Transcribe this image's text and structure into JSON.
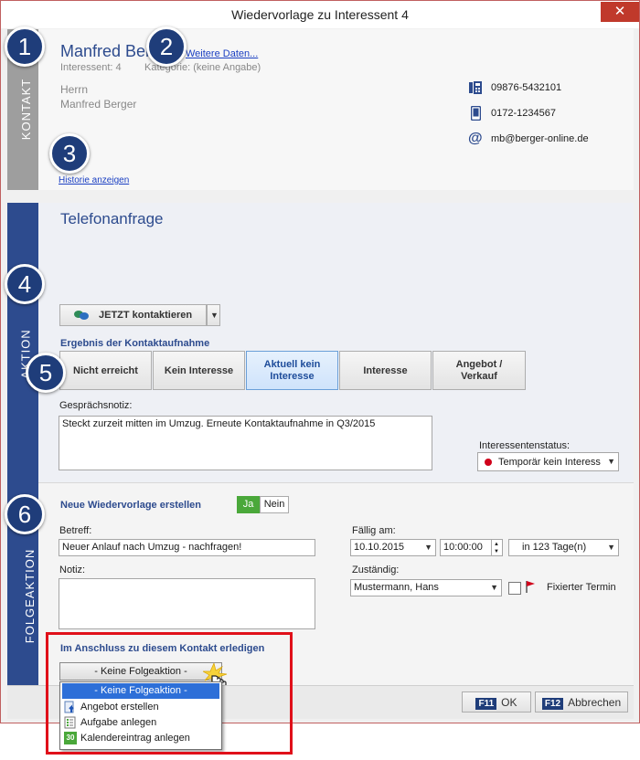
{
  "window": {
    "title": "Wiedervorlage zu Interessent 4",
    "close": "✕"
  },
  "badges": [
    "1",
    "2",
    "3",
    "4",
    "5",
    "6"
  ],
  "sidebar": {
    "kontakt": "KONTAKT",
    "aktion": "AKTION",
    "folgeaktion": "FOLGEAKTION"
  },
  "contact": {
    "name": "Manfred Berger",
    "interessent": "Interessent: 4",
    "kategorie": "Kategorie: (keine Angabe)",
    "weitere_daten": "Weitere Daten...",
    "salutation": "Herrn",
    "fullname": "Manfred Berger",
    "phone": "09876-5432101",
    "mobile": "0172-1234567",
    "email": "mb@berger-online.de",
    "historie": "Historie anzeigen"
  },
  "aktion": {
    "title": "Telefonanfrage",
    "contact_button": "JETZT kontaktieren",
    "ergebnis_title": "Ergebnis der Kontaktaufnahme",
    "results": [
      "Nicht erreicht",
      "Kein Interesse",
      "Aktuell kein Interesse",
      "Interesse",
      "Angebot / Verkauf"
    ],
    "active_result": "Aktuell kein Interesse",
    "notiz_label": "Gesprächsnotiz:",
    "notiz_value": "Steckt zurzeit mitten im Umzug. Erneute Kontaktaufnahme in Q3/2015",
    "status_label": "Interessentenstatus:",
    "status_value": "Temporär kein Interess",
    "status_color": "#d0021b"
  },
  "folge": {
    "title": "Neue Wiedervorlage erstellen",
    "ja": "Ja",
    "nein": "Nein",
    "betreff_label": "Betreff:",
    "betreff_value": "Neuer Anlauf nach Umzug - nachfragen!",
    "faellig_label": "Fällig am:",
    "date": "10.10.2015",
    "time": "10:00:00",
    "days": "in 123 Tage(n)",
    "notiz_label": "Notiz:",
    "zustaendig_label": "Zuständig:",
    "zustaendig_value": "Mustermann, Hans",
    "fixiert": "Fixierter Termin",
    "erledigen_title": "Im Anschluss zu diesem Kontakt erledigen",
    "select_value": "- Keine Folgeaktion -",
    "options": [
      "- Keine Folgeaktion -",
      "Angebot erstellen",
      "Aufgabe anlegen",
      "Kalendereintrag anlegen"
    ],
    "calendar_icon_text": "30"
  },
  "footer": {
    "ok_key": "F11",
    "ok": "OK",
    "cancel_key": "F12",
    "cancel": "Abbrechen"
  },
  "colors": {
    "accent": "#2d4b8e",
    "badge": "#1f3d7a",
    "highlight": "#e0101a",
    "link": "#1a3fc2",
    "ja_green": "#4aa83a"
  }
}
